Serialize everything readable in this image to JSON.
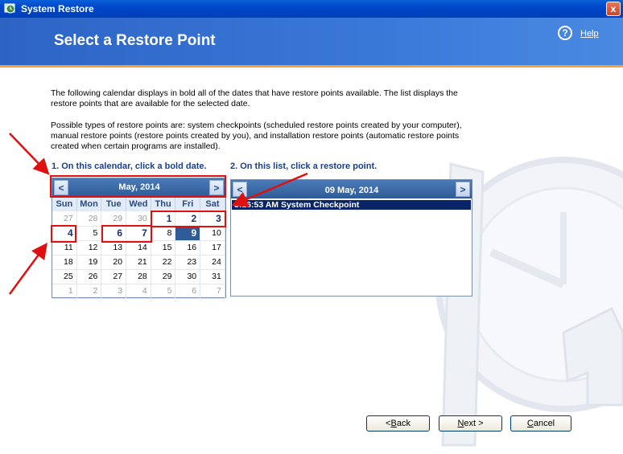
{
  "window": {
    "title": "System Restore",
    "close_symbol": "x"
  },
  "header": {
    "heading": "Select a Restore Point",
    "help_symbol": "?",
    "help_link": "Help"
  },
  "body": {
    "intro": "The following calendar displays in bold all of the dates that have restore points available. The list displays the restore points that are available for the selected date.",
    "types": "Possible types of restore points are: system checkpoints (scheduled restore points created by your computer), manual restore points (restore points created by you), and installation restore points (automatic restore points created when certain programs are installed).",
    "step1": "1. On this calendar, click a bold date.",
    "step2": "2. On this list, click a restore point."
  },
  "calendar": {
    "prev": "<",
    "next": ">",
    "month": "May, 2014",
    "days_of_week": [
      "Sun",
      "Mon",
      "Tue",
      "Wed",
      "Thu",
      "Fri",
      "Sat"
    ],
    "weeks": [
      [
        {
          "d": "27",
          "t": "other"
        },
        {
          "d": "28",
          "t": "other"
        },
        {
          "d": "29",
          "t": "other"
        },
        {
          "d": "30",
          "t": "other"
        },
        {
          "d": "1",
          "t": "bold"
        },
        {
          "d": "2",
          "t": "bold"
        },
        {
          "d": "3",
          "t": "bold"
        }
      ],
      [
        {
          "d": "4",
          "t": "bold"
        },
        {
          "d": "5",
          "t": ""
        },
        {
          "d": "6",
          "t": "bold"
        },
        {
          "d": "7",
          "t": "bold"
        },
        {
          "d": "8",
          "t": ""
        },
        {
          "d": "9",
          "t": "selected"
        },
        {
          "d": "10",
          "t": ""
        }
      ],
      [
        {
          "d": "11",
          "t": ""
        },
        {
          "d": "12",
          "t": ""
        },
        {
          "d": "13",
          "t": ""
        },
        {
          "d": "14",
          "t": ""
        },
        {
          "d": "15",
          "t": ""
        },
        {
          "d": "16",
          "t": ""
        },
        {
          "d": "17",
          "t": ""
        }
      ],
      [
        {
          "d": "18",
          "t": ""
        },
        {
          "d": "19",
          "t": ""
        },
        {
          "d": "20",
          "t": ""
        },
        {
          "d": "21",
          "t": ""
        },
        {
          "d": "22",
          "t": ""
        },
        {
          "d": "23",
          "t": ""
        },
        {
          "d": "24",
          "t": ""
        }
      ],
      [
        {
          "d": "25",
          "t": ""
        },
        {
          "d": "26",
          "t": ""
        },
        {
          "d": "27",
          "t": ""
        },
        {
          "d": "28",
          "t": ""
        },
        {
          "d": "29",
          "t": ""
        },
        {
          "d": "30",
          "t": ""
        },
        {
          "d": "31",
          "t": ""
        }
      ],
      [
        {
          "d": "1",
          "t": "other"
        },
        {
          "d": "2",
          "t": "other"
        },
        {
          "d": "3",
          "t": "other"
        },
        {
          "d": "4",
          "t": "other"
        },
        {
          "d": "5",
          "t": "other"
        },
        {
          "d": "6",
          "t": "other"
        },
        {
          "d": "7",
          "t": "other"
        }
      ]
    ]
  },
  "restore_list": {
    "prev": "<",
    "next": ">",
    "date": "09 May, 2014",
    "items": [
      {
        "label": "3:16:53 AM  System Checkpoint",
        "selected": true
      }
    ]
  },
  "buttons": {
    "back": {
      "prefix": "< ",
      "access_key": "B",
      "rest": "ack"
    },
    "next": {
      "access_key": "N",
      "rest": "ext >"
    },
    "cancel": {
      "access_key": "C",
      "rest": "ancel"
    }
  },
  "colors": {
    "annotation": "#e01010",
    "header": "#3a78d8",
    "selection": "#0a246a"
  }
}
